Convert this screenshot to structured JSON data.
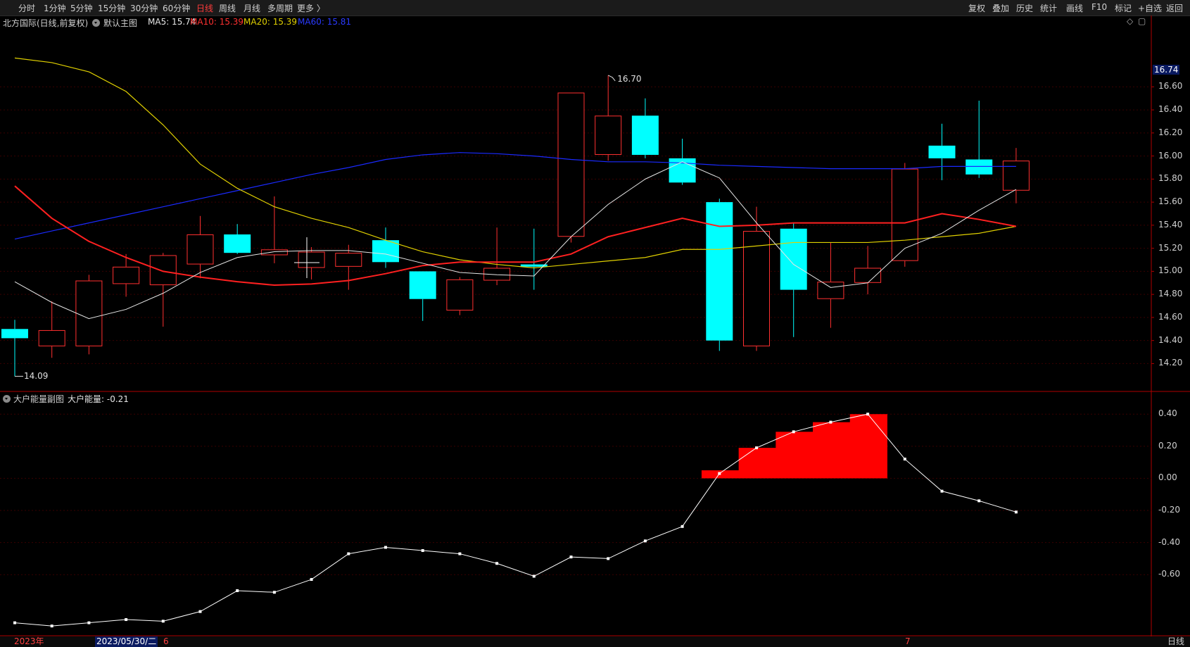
{
  "toolbar": {
    "periods": [
      "分时",
      "1分钟",
      "5分钟",
      "15分钟",
      "30分钟",
      "60分钟",
      "日线",
      "周线",
      "月线",
      "多周期",
      "更多 〉"
    ],
    "active_period": "日线",
    "right_buttons": [
      "复权",
      "叠加",
      "历史",
      "统计",
      "画线",
      "F10",
      "标记",
      "+自选",
      "返回"
    ]
  },
  "main_legend": {
    "title": "北方国际(日线,前复权)",
    "indicator": "默认主图",
    "ma5": "MA5: 15.74",
    "ma10": "MA10: 15.39",
    "ma20": "MA20: 15.39",
    "ma60": "MA60: 15.81"
  },
  "sub_legend": {
    "title": "大户能量副图",
    "value": "大户能量: -0.21"
  },
  "price_axis": {
    "current": "16.74",
    "labels": [
      "16.60",
      "16.40",
      "16.20",
      "16.00",
      "15.80",
      "15.60",
      "15.40",
      "15.20",
      "15.00",
      "14.80",
      "14.60",
      "14.40",
      "14.20"
    ]
  },
  "sub_axis": {
    "labels": [
      "0.40",
      "0.20",
      "0.00",
      "-0.20",
      "-0.40",
      "-0.60"
    ]
  },
  "annotations": {
    "high": "16.70",
    "low": "14.09"
  },
  "bottom": {
    "year": "2023年",
    "cursor_date": "2023/05/30/二",
    "month_6": "6",
    "month_7": "7",
    "period": "日线"
  },
  "colors": {
    "up": "#ff3030",
    "down": "#00ffff",
    "ma5": "#e6e6e6",
    "ma10": "#ff2020",
    "ma20": "#e0d000",
    "ma60": "#1a2aff",
    "energy": "#ff0000"
  },
  "chart_data": {
    "type": "candlestick",
    "candles": [
      {
        "o": 14.5,
        "h": 14.58,
        "l": 14.09,
        "c": 14.42
      },
      {
        "o": 14.35,
        "h": 14.74,
        "l": 14.25,
        "c": 14.49
      },
      {
        "o": 14.35,
        "h": 14.97,
        "l": 14.28,
        "c": 14.92
      },
      {
        "o": 14.89,
        "h": 15.15,
        "l": 14.78,
        "c": 15.04
      },
      {
        "o": 14.88,
        "h": 15.16,
        "l": 14.52,
        "c": 15.14
      },
      {
        "o": 15.06,
        "h": 15.48,
        "l": 14.94,
        "c": 15.32
      },
      {
        "o": 15.32,
        "h": 15.41,
        "l": 15.15,
        "c": 15.16
      },
      {
        "o": 15.14,
        "h": 15.65,
        "l": 15.07,
        "c": 15.19
      },
      {
        "o": 15.03,
        "h": 15.21,
        "l": 14.93,
        "c": 15.17
      },
      {
        "o": 15.04,
        "h": 15.23,
        "l": 14.84,
        "c": 15.16
      },
      {
        "o": 15.27,
        "h": 15.38,
        "l": 15.03,
        "c": 15.08
      },
      {
        "o": 15.0,
        "h": 15.0,
        "l": 14.57,
        "c": 14.76
      },
      {
        "o": 14.66,
        "h": 14.95,
        "l": 14.62,
        "c": 14.93
      },
      {
        "o": 14.92,
        "h": 15.38,
        "l": 14.88,
        "c": 15.03
      },
      {
        "o": 15.06,
        "h": 15.37,
        "l": 14.84,
        "c": 15.04
      },
      {
        "o": 15.3,
        "h": 16.55,
        "l": 15.25,
        "c": 16.55
      },
      {
        "o": 16.01,
        "h": 16.7,
        "l": 15.96,
        "c": 16.35
      },
      {
        "o": 16.35,
        "h": 16.5,
        "l": 15.98,
        "c": 16.01
      },
      {
        "o": 15.98,
        "h": 16.15,
        "l": 15.75,
        "c": 15.77
      },
      {
        "o": 15.6,
        "h": 15.63,
        "l": 14.31,
        "c": 14.4
      },
      {
        "o": 14.35,
        "h": 15.56,
        "l": 14.31,
        "c": 15.35
      },
      {
        "o": 15.37,
        "h": 15.42,
        "l": 14.43,
        "c": 14.84
      },
      {
        "o": 14.76,
        "h": 15.25,
        "l": 14.51,
        "c": 14.91
      },
      {
        "o": 14.9,
        "h": 15.22,
        "l": 14.8,
        "c": 15.03
      },
      {
        "o": 15.09,
        "h": 15.94,
        "l": 15.04,
        "c": 15.89
      },
      {
        "o": 16.09,
        "h": 16.28,
        "l": 15.79,
        "c": 15.98
      },
      {
        "o": 15.97,
        "h": 16.48,
        "l": 15.81,
        "c": 15.84
      },
      {
        "o": 15.7,
        "h": 16.07,
        "l": 15.59,
        "c": 15.96
      }
    ],
    "ma5": [
      14.91,
      14.73,
      14.59,
      14.67,
      14.81,
      14.99,
      15.12,
      15.17,
      15.18,
      15.18,
      15.15,
      15.07,
      14.99,
      14.97,
      14.96,
      15.3,
      15.58,
      15.8,
      15.95,
      15.81,
      15.42,
      15.06,
      14.86,
      14.9,
      15.2,
      15.33,
      15.53,
      15.71
    ],
    "ma10": [
      15.74,
      15.46,
      15.26,
      15.12,
      15.0,
      14.95,
      14.91,
      14.88,
      14.89,
      14.92,
      14.98,
      15.05,
      15.08,
      15.08,
      15.08,
      15.15,
      15.3,
      15.38,
      15.46,
      15.39,
      15.4,
      15.42,
      15.42,
      15.42,
      15.42,
      15.5,
      15.45,
      15.39
    ],
    "ma20": [
      16.85,
      16.81,
      16.73,
      16.56,
      16.27,
      15.93,
      15.72,
      15.56,
      15.46,
      15.38,
      15.27,
      15.17,
      15.1,
      15.06,
      15.03,
      15.06,
      15.09,
      15.12,
      15.19,
      15.19,
      15.22,
      15.25,
      15.25,
      15.25,
      15.27,
      15.3,
      15.33,
      15.39
    ],
    "ma60": [
      15.28,
      15.35,
      15.42,
      15.49,
      15.56,
      15.63,
      15.7,
      15.77,
      15.84,
      15.9,
      15.97,
      16.01,
      16.03,
      16.02,
      16.0,
      15.97,
      15.95,
      15.95,
      15.94,
      15.92,
      15.91,
      15.9,
      15.89,
      15.89,
      15.89,
      15.91,
      15.91,
      15.91
    ],
    "energy_line": [
      -0.9,
      -0.92,
      -0.9,
      -0.88,
      -0.89,
      -0.83,
      -0.7,
      -0.71,
      -0.63,
      -0.47,
      -0.43,
      -0.45,
      -0.47,
      -0.53,
      -0.61,
      -0.49,
      -0.5,
      -0.39,
      -0.3,
      0.03,
      0.19,
      0.29,
      0.35,
      0.4,
      0.12,
      -0.08,
      -0.14,
      -0.21
    ],
    "energy_bars": [
      0,
      0,
      0,
      0,
      0,
      0,
      0,
      0,
      0,
      0,
      0,
      0,
      0,
      0,
      0,
      0,
      0,
      0,
      0,
      0.05,
      0.19,
      0.29,
      0.35,
      0.4,
      0,
      0,
      0,
      0
    ],
    "price_ylim": [
      14.05,
      16.95
    ],
    "energy_ylim": [
      -0.95,
      0.48
    ]
  }
}
